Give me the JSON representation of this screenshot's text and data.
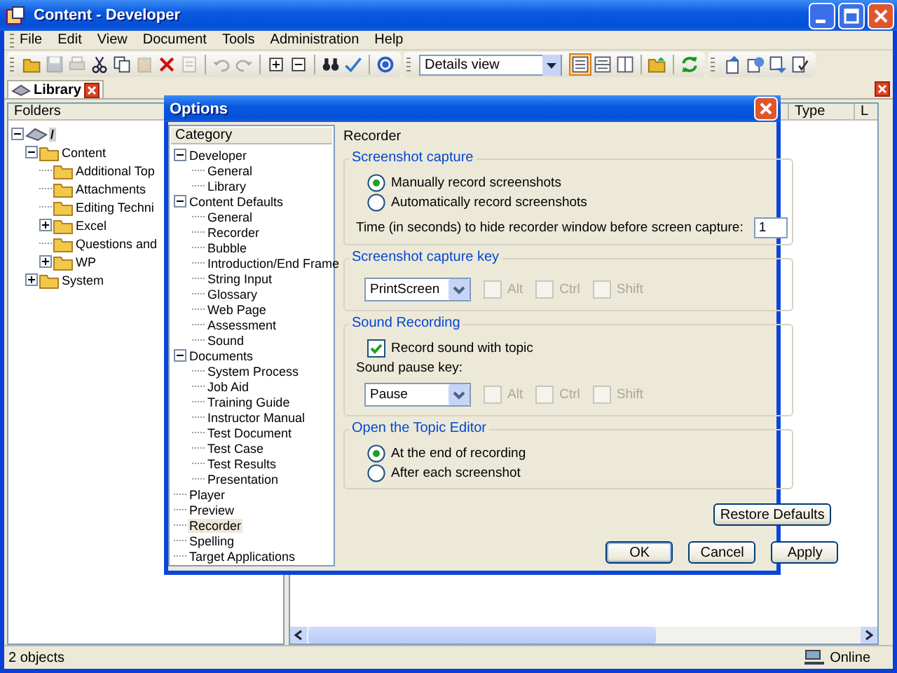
{
  "window": {
    "title": "Content - Developer"
  },
  "menu": [
    "File",
    "Edit",
    "View",
    "Document",
    "Tools",
    "Administration",
    "Help"
  ],
  "toolbar": {
    "groups": [
      [
        {
          "disabled": false
        },
        {
          "disabled": true
        },
        {
          "disabled": true
        },
        {
          "disabled": false
        },
        {
          "disabled": false
        },
        {
          "disabled": true
        },
        {
          "disabled": false
        },
        {
          "disabled": true
        }
      ],
      [
        {
          "disabled": true
        },
        {
          "disabled": true
        }
      ],
      [
        {
          "disabled": false
        },
        {
          "disabled": false
        }
      ],
      [
        {
          "disabled": false
        },
        {
          "disabled": false
        }
      ],
      [
        {
          "disabled": false
        }
      ]
    ],
    "view_select": "Details view",
    "view_buttons": [
      {
        "selected": true
      },
      {
        "selected": false
      },
      {
        "selected": false
      }
    ]
  },
  "tabs": [
    {
      "label": "Library",
      "selected": true
    }
  ],
  "folders": {
    "header": "Folders",
    "tree": [
      {
        "label": "/",
        "expanded": true,
        "children": [
          {
            "label": "Content",
            "expanded": true,
            "children": [
              {
                "label": "Additional Top"
              },
              {
                "label": "Attachments"
              },
              {
                "label": "Editing Techni"
              },
              {
                "label": "Excel",
                "expanded": false
              },
              {
                "label": "Questions and"
              },
              {
                "label": "WP",
                "expanded": false
              }
            ]
          },
          {
            "label": "System",
            "expanded": false
          }
        ]
      }
    ]
  },
  "list": {
    "columns": [
      "Type",
      "L"
    ]
  },
  "status_bar": {
    "count": "2 objects",
    "connection": "Online"
  },
  "dialog": {
    "title": "Options",
    "category_header": "Category",
    "categories": [
      {
        "label": "Developer",
        "expanded": true,
        "selected": false,
        "children": [
          {
            "label": "General",
            "selected": false
          },
          {
            "label": "Library",
            "selected": false
          }
        ]
      },
      {
        "label": "Content Defaults",
        "expanded": true,
        "selected": false,
        "children": [
          {
            "label": "General",
            "selected": false
          },
          {
            "label": "Recorder",
            "selected": false
          },
          {
            "label": "Bubble",
            "selected": false
          },
          {
            "label": "Introduction/End Frame",
            "selected": false
          },
          {
            "label": "String Input",
            "selected": false
          },
          {
            "label": "Glossary",
            "selected": false
          },
          {
            "label": "Web Page",
            "selected": false
          },
          {
            "label": "Assessment",
            "selected": false
          },
          {
            "label": "Sound",
            "selected": false
          }
        ]
      },
      {
        "label": "Documents",
        "expanded": true,
        "selected": false,
        "children": [
          {
            "label": "System Process",
            "selected": false
          },
          {
            "label": "Job Aid",
            "selected": false
          },
          {
            "label": "Training Guide",
            "selected": false
          },
          {
            "label": "Instructor Manual",
            "selected": false
          },
          {
            "label": "Test Document",
            "selected": false
          },
          {
            "label": "Test Case",
            "selected": false
          },
          {
            "label": "Test Results",
            "selected": false
          },
          {
            "label": "Presentation",
            "selected": false
          }
        ]
      },
      {
        "label": "Player",
        "selected": false
      },
      {
        "label": "Preview",
        "selected": false
      },
      {
        "label": "Recorder",
        "selected": true
      },
      {
        "label": "Spelling",
        "selected": false
      },
      {
        "label": "Target Applications",
        "selected": false
      }
    ],
    "page_title": "Recorder",
    "groups": [
      {
        "title": "Screenshot capture",
        "items": [
          {
            "kind": "radio",
            "label": "Manually record screenshots",
            "selected": true
          },
          {
            "kind": "radio",
            "label": "Automatically record screenshots",
            "selected": false
          },
          {
            "kind": "number",
            "label": "Time (in seconds) to hide recorder window before screen capture:",
            "value": "1"
          }
        ]
      },
      {
        "title": "Screenshot capture key",
        "items": [
          {
            "kind": "key",
            "value": "PrintScreen",
            "modifiers": [
              {
                "label": "Alt",
                "checked": false,
                "disabled": true
              },
              {
                "label": "Ctrl",
                "checked": false,
                "disabled": true
              },
              {
                "label": "Shift",
                "checked": false,
                "disabled": true
              }
            ]
          }
        ]
      },
      {
        "title": "Sound Recording",
        "items": [
          {
            "kind": "checkbox",
            "label": "Record sound with topic",
            "checked": true
          },
          {
            "kind": "label",
            "label": "Sound pause key:"
          },
          {
            "kind": "key",
            "value": "Pause",
            "modifiers": [
              {
                "label": "Alt",
                "checked": false,
                "disabled": true
              },
              {
                "label": "Ctrl",
                "checked": false,
                "disabled": true
              },
              {
                "label": "Shift",
                "checked": false,
                "disabled": true
              }
            ]
          }
        ]
      },
      {
        "title": "Open the Topic Editor",
        "items": [
          {
            "kind": "radio",
            "label": "At the end of recording",
            "selected": true
          },
          {
            "kind": "radio",
            "label": "After each screenshot",
            "selected": false
          }
        ]
      }
    ],
    "restore_button": "Restore Defaults",
    "buttons": [
      {
        "label": "OK",
        "default": true
      },
      {
        "label": "Cancel",
        "default": false
      },
      {
        "label": "Apply",
        "default": false
      }
    ]
  }
}
